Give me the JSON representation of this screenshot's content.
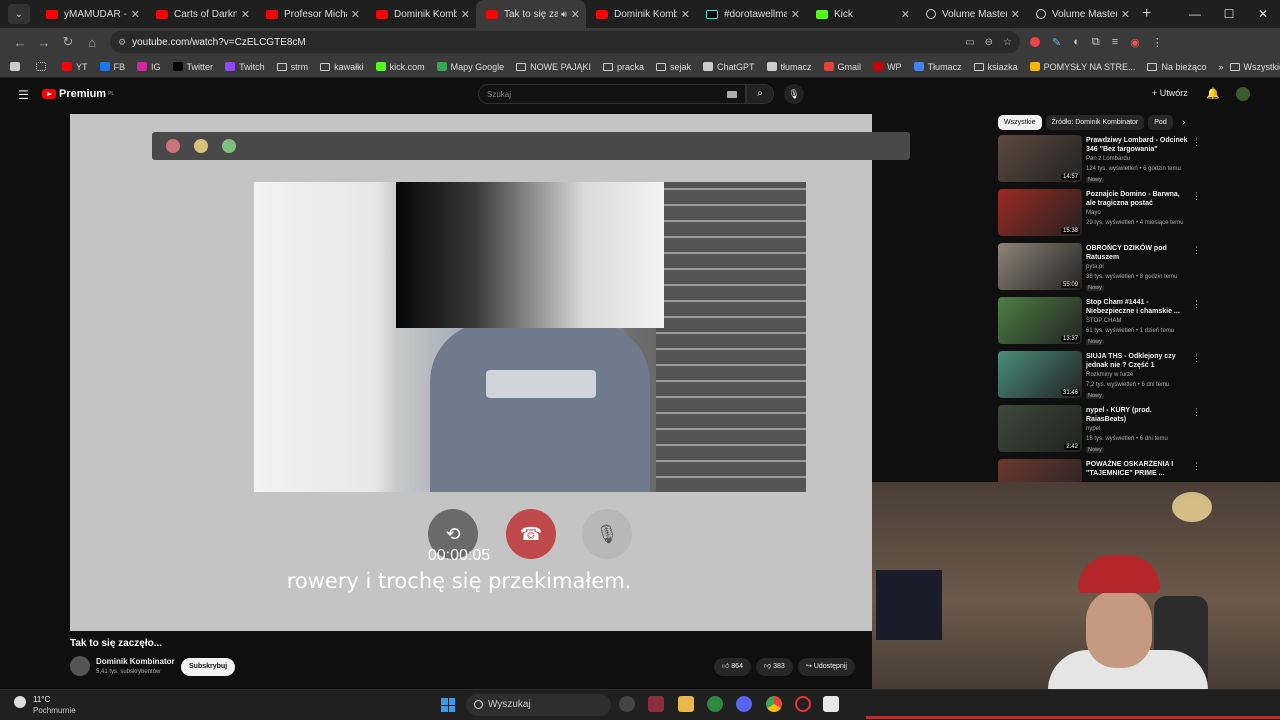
{
  "tabs": [
    {
      "label": "yMAMUDAR - Yo",
      "icon": "youtube-icon"
    },
    {
      "label": "Carts of Darkness",
      "icon": "youtube-icon"
    },
    {
      "label": "Profesor Michael",
      "icon": "youtube-icon"
    },
    {
      "label": "Dominik Kombinat",
      "icon": "youtube-icon"
    },
    {
      "label": "Tak to się zacz",
      "icon": "youtube-icon",
      "active": true,
      "audio": true
    },
    {
      "label": "Dominik Kombinat",
      "icon": "youtube-icon"
    },
    {
      "label": "#dorotawellman",
      "icon": "tiktok-icon"
    },
    {
      "label": "Kick",
      "icon": "kick-icon"
    },
    {
      "label": "Volume Master -",
      "icon": "extension-icon"
    },
    {
      "label": "Volume Master |",
      "icon": "extension-icon"
    }
  ],
  "omnibox": {
    "url": "youtube.com/watch?v=CzELCGTE8cM"
  },
  "bookmarks": [
    "YT",
    "FB",
    "IG",
    "Twitter",
    "Twitch",
    "strm",
    "kawałki",
    "kick.com",
    "Mapy Google",
    "NOWE PAJĄKI",
    "pracka",
    "sejak",
    "ChatGPT",
    "tłumacz",
    "Gmail",
    "WP",
    "Tłumacz",
    "ksiazka",
    "POMYSŁY NA STRE...",
    "Na bieżąco"
  ],
  "bookmarks_other": "Wszystkie zakładki",
  "youtube": {
    "logo": "Premium",
    "logo_region": "PL",
    "search_placeholder": "Szukaj",
    "create_label": "Utwórz"
  },
  "player": {
    "timer": "00:00:05",
    "subtitle": "rowery i trochę się przekimałem."
  },
  "video": {
    "title": "Tak to się zaczęło...",
    "channel": "Dominik Kombinator",
    "subscribers": "5,41 tys. subskrybentów",
    "subscribe_label": "Subskrybuj",
    "likes": "864",
    "dislikes": "383",
    "share_label": "Udostępnij"
  },
  "chips": [
    "Wszystkie",
    "Źródło: Dominik Kombinator",
    "Pod"
  ],
  "recommendations": [
    {
      "title": "Prawdziwy Lombard - Odcinek 346 \"Bez targowania\"",
      "channel": "Pan z Lombardu",
      "meta": "124 tys. wyświetleń • 6 godzin temu",
      "badge": "Nowy",
      "duration": "14:57",
      "thumb": "#5d4a3d"
    },
    {
      "title": "Poznajcie Domino - Barwna, ale tragiczna postać",
      "channel": "Mayo",
      "meta": "29 tys. wyświetleń • 4 miesiące temu",
      "badge": "",
      "duration": "15:38",
      "thumb": "#9c2a22"
    },
    {
      "title": "OBROŃCY DZIKÓW pod Ratuszem",
      "channel": "pyta.pl",
      "meta": "38 tys. wyświetleń • 8 godzin temu",
      "badge": "Nowy",
      "duration": "55:09",
      "thumb": "#8f8478"
    },
    {
      "title": "Stop Cham #1441 - Niebezpieczne i chamskie ...",
      "channel": "STOP CHAM",
      "meta": "61 tys. wyświetleń • 1 dzień temu",
      "badge": "Nowy",
      "duration": "13:37",
      "thumb": "#4f7f45"
    },
    {
      "title": "SIUJA THS - Odklejony czy jednak nie ? Część 1",
      "channel": "Rozkminy w furze",
      "meta": "7,2 tys. wyświetleń • 6 dni temu",
      "badge": "Nowy",
      "duration": "31:46",
      "thumb": "#4a8e7a"
    },
    {
      "title": "nypel - KURY (prod. RaiasBeats)",
      "channel": "nypel",
      "meta": "18 tys. wyświetleń • 6 dni temu",
      "badge": "Nowy",
      "duration": "2:42",
      "thumb": "#3d4a3a"
    },
    {
      "title": "POWAŻNE OSKARŻENIA I \"TAJEMNICE\" PRIME ...",
      "channel": "",
      "meta": "",
      "badge": "",
      "duration": "",
      "thumb": "#6d3830"
    }
  ],
  "taskbar": {
    "temperature": "11°C",
    "condition": "Pochmurnie",
    "search_label": "Wyszukaj"
  },
  "colors": {
    "brand": "#ff0000",
    "hangup": "#c0494c",
    "youtube_bg": "#0f0f0f"
  }
}
